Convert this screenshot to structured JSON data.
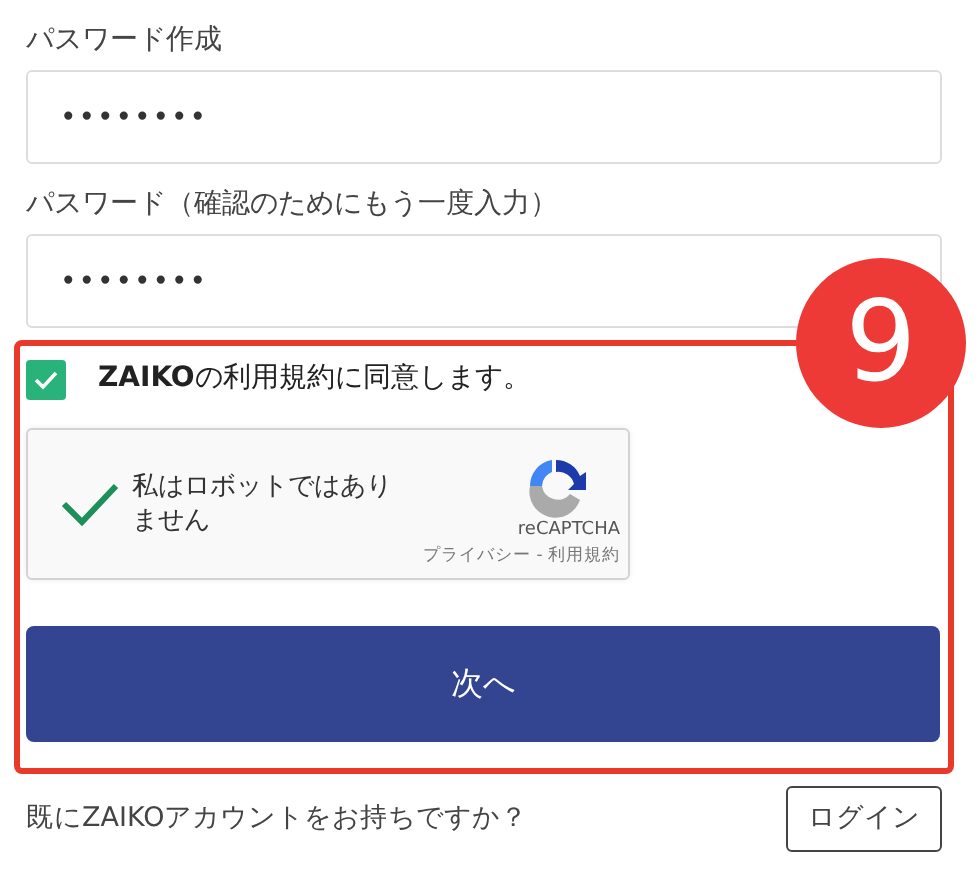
{
  "fields": [
    {
      "label": "パスワード作成",
      "value": "••••••••"
    },
    {
      "label": "パスワード（確認のためにもう一度入力）",
      "value": "••••••••"
    }
  ],
  "highlight": {
    "badge": "9"
  },
  "terms": {
    "label": "**ZAIKO**の利用規約に同意します。",
    "checked": true
  },
  "recaptcha": {
    "label": "私はロボットではありません",
    "checked": true,
    "brand": "reCAPTCHA",
    "links": "プライバシー - 利用規約"
  },
  "next_button": "次へ",
  "footer": {
    "text": "既にZAIKOアカウントをお持ちですか？",
    "login_button": "ログイン"
  }
}
